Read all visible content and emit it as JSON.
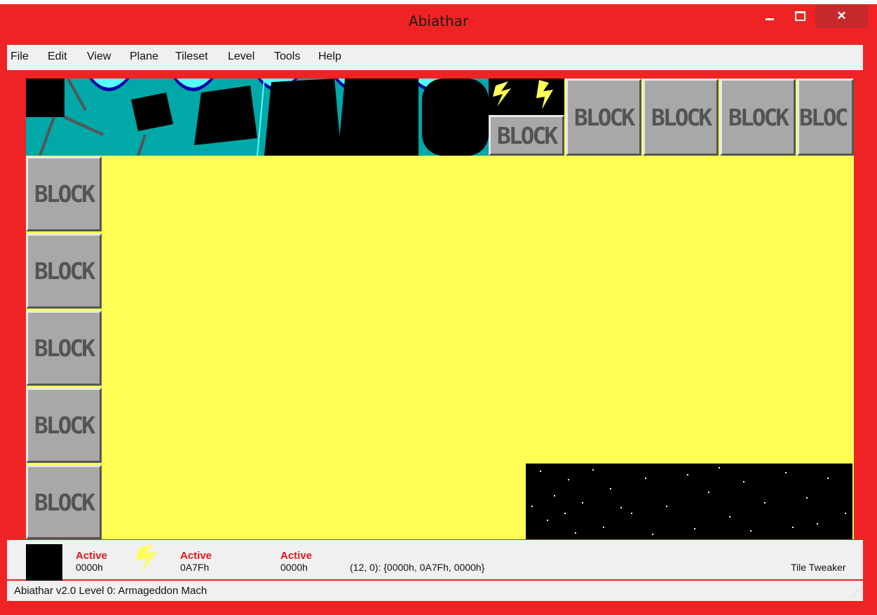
{
  "window": {
    "title": "Abiathar"
  },
  "menu": [
    "File",
    "Edit",
    "View",
    "Plane",
    "Tileset",
    "Level",
    "Tools",
    "Help"
  ],
  "tiles": {
    "block_label": "BLOCK",
    "block_partial_label": "BLOC"
  },
  "tile_info": {
    "fg": {
      "state": "Active",
      "value": "0000h"
    },
    "bg": {
      "state": "Active",
      "value": "0A7Fh"
    },
    "info": {
      "state": "Active",
      "value": "0000h"
    },
    "coords": "(12, 0): {0000h, 0A7Fh, 0000h}",
    "tweaker": "Tile Tweaker"
  },
  "statusbar": {
    "text": "Abiathar v2.0  Level 0: Armageddon Mach"
  },
  "colors": {
    "frame": "#ef2323",
    "canvas_bg": "#ffff55",
    "active_label": "#e01818",
    "teal": "#00a8a8",
    "block_gray": "#a8a8a8"
  }
}
